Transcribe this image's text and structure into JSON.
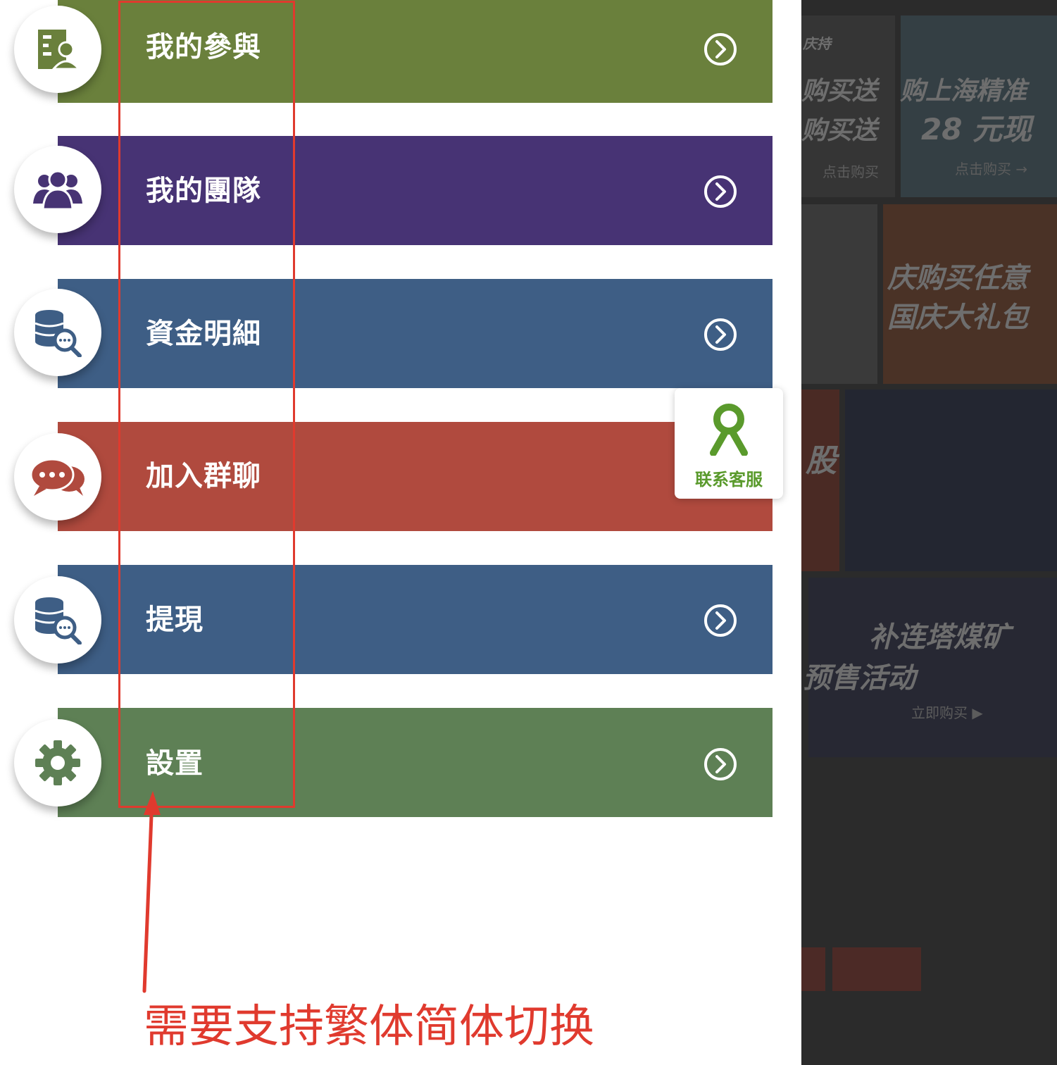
{
  "menu": {
    "items": [
      {
        "label": "我的參與",
        "icon": "participation-doc-icon",
        "color": "#6a803c"
      },
      {
        "label": "我的團隊",
        "icon": "team-users-icon",
        "color": "#473374"
      },
      {
        "label": "資金明細",
        "icon": "database-search-icon",
        "color": "#3e5e85"
      },
      {
        "label": "加入群聊",
        "icon": "chat-bubbles-icon",
        "color": "#b04a3e"
      },
      {
        "label": "提現",
        "icon": "database-search-icon",
        "color": "#3e5e85"
      },
      {
        "label": "設置",
        "icon": "gear-icon",
        "color": "#5e8055"
      }
    ],
    "arrow_icon": "chevron-right-circle-icon"
  },
  "service_button": {
    "label": "联系客服",
    "icon": "customer-service-icon",
    "color": "#5a9a2c"
  },
  "annotation": {
    "note": "需要支持繁体简体切换",
    "color": "#e03a2e"
  },
  "background_page": {
    "texts": [
      "庆持",
      "购买送",
      "购上海精准",
      "购买送",
      "28 元现",
      "点击购买",
      "点击购买 →",
      "庆购买任意",
      "国庆大礼包",
      "股",
      "补连塔煤矿",
      "预售活动",
      "立即购买 ▶"
    ]
  }
}
